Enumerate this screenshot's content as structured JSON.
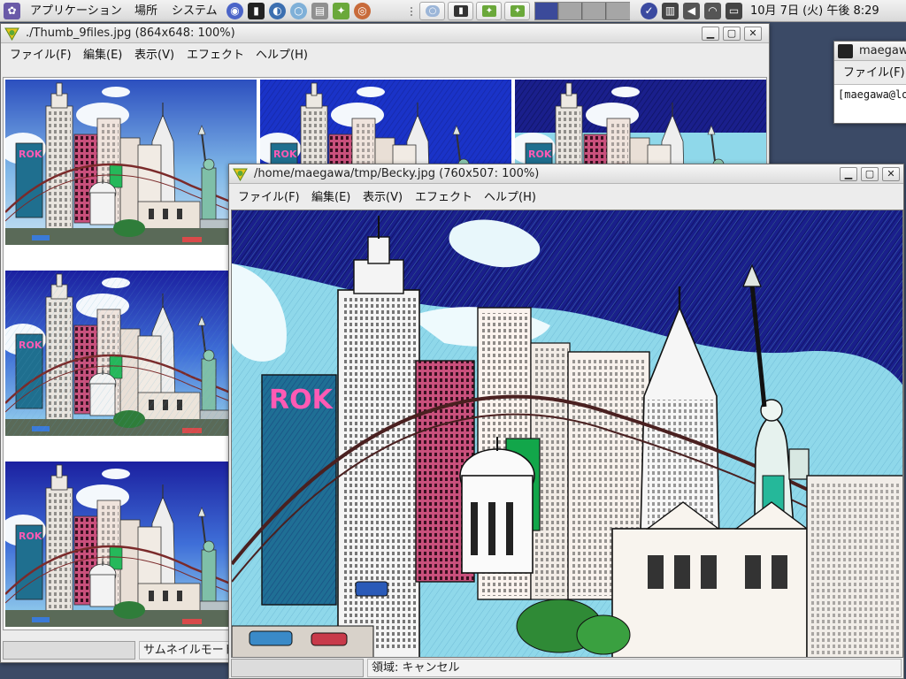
{
  "panel": {
    "menu_applications": "アプリケーション",
    "menu_places": "場所",
    "menu_system": "システム",
    "clock": "10月 7日 (火) 午後 8:29",
    "launchers": [
      "firefox-icon",
      "web-browser-icon",
      "terminal-icon",
      "disk-icon",
      "gimp-icon"
    ],
    "tray": [
      "vpn-icon",
      "battery-icon",
      "volume-icon",
      "network-icon",
      "display-icon"
    ]
  },
  "thumb_window": {
    "title": "./Thumb_9files.jpg (864x648: 100%)",
    "menu": [
      "ファイル(F)",
      "編集(E)",
      "表示(V)",
      "エフェクト",
      "ヘルプ(H)"
    ],
    "status_mode": "サムネイルモード"
  },
  "terminal_window": {
    "title": "maegawa",
    "menu": [
      "ファイル(F)"
    ],
    "prompt": "[maegawa@lo"
  },
  "main_window": {
    "title": "/home/maegawa/tmp/Becky.jpg (760x507: 100%)",
    "menu": [
      "ファイル(F)",
      "編集(E)",
      "表示(V)",
      "エフェクト",
      "ヘルプ(H)"
    ],
    "status_text": "領域: キャンセル"
  },
  "colors": {
    "sky_dark": "#1a1f8c",
    "sky_light": "#8fd8ea",
    "panel": "#e6e6e6",
    "window_bg": "#ececec"
  }
}
